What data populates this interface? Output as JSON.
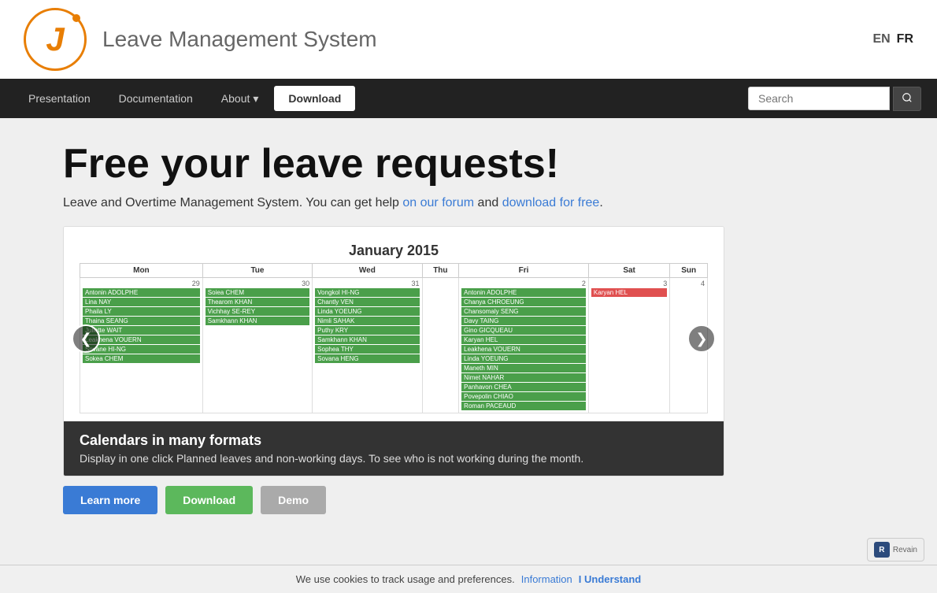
{
  "header": {
    "title": "Leave Management System",
    "lang_en": "EN",
    "lang_fr": "FR"
  },
  "navbar": {
    "presentation": "Presentation",
    "documentation": "Documentation",
    "about": "About",
    "about_arrow": "▾",
    "download": "Download",
    "search_placeholder": "Search"
  },
  "hero": {
    "title": "Free your leave requests!",
    "subtitle_pre": "Leave and Overtime Management System. You can get help ",
    "link1_text": "on our forum",
    "subtitle_mid": " and ",
    "link2_text": "download for free",
    "subtitle_post": "."
  },
  "carousel": {
    "caption_title": "Calendars in many formats",
    "caption_text": "Display in one click Planned leaves and non-working days. To see who is not working during the month."
  },
  "calendar": {
    "title": "January 2015",
    "headers": [
      "Mon",
      "Tue",
      "Wed",
      "Thu",
      "Fri",
      "Sat",
      "Sun"
    ],
    "day_numbers": [
      "29",
      "30",
      "31",
      "",
      "2",
      "3",
      "4"
    ]
  },
  "action_buttons": {
    "btn1": "Learn more",
    "btn2": "Download",
    "btn3": "Demo"
  },
  "cookie": {
    "text": "We use cookies to track usage and preferences.",
    "info_link": "Information",
    "understand_link": "I Understand"
  },
  "revain": {
    "label": "Revain"
  }
}
